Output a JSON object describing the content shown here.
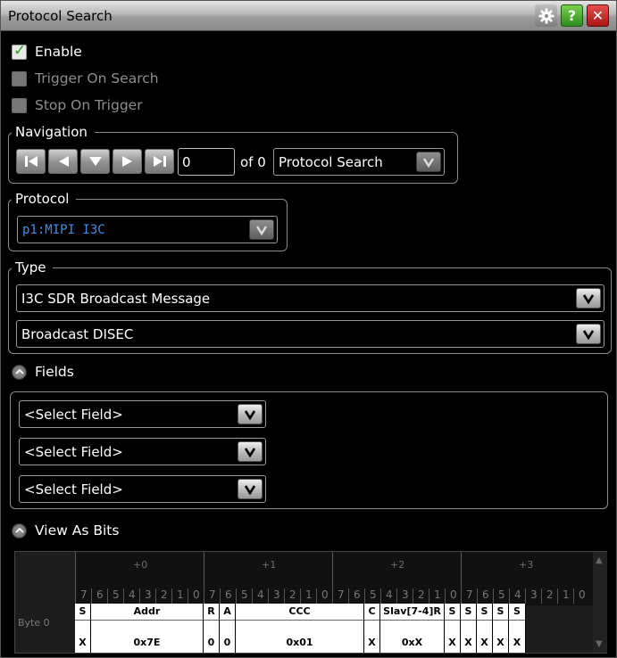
{
  "window": {
    "title": "Protocol Search"
  },
  "options": {
    "enable_label": "Enable",
    "trigger_on_search_label": "Trigger On Search",
    "stop_on_trigger_label": "Stop On Trigger"
  },
  "navigation": {
    "title": "Navigation",
    "index_value": "0",
    "of_label": "of 0",
    "mode_value": "Protocol Search"
  },
  "protocol": {
    "title": "Protocol",
    "value": "p1:MIPI I3C"
  },
  "type": {
    "title": "Type",
    "primary_value": "I3C SDR Broadcast Message",
    "secondary_value": "Broadcast DISEC"
  },
  "fields": {
    "title": "Fields",
    "selectors": [
      "<Select Field>",
      "<Select Field>",
      "<Select Field>"
    ]
  },
  "view_as_bits": {
    "title": "View As Bits",
    "byte_label": "Byte 0",
    "group_labels": [
      "+0",
      "+1",
      "+2",
      "+3"
    ],
    "bit_numbers": [
      "7",
      "6",
      "5",
      "4",
      "3",
      "2",
      "1",
      "0",
      "7",
      "6",
      "5",
      "4",
      "3",
      "2",
      "1",
      "0",
      "7",
      "6",
      "5",
      "4",
      "3",
      "2",
      "1",
      "0",
      "7",
      "6",
      "5",
      "4",
      "3",
      "2",
      "1",
      "0"
    ],
    "fields": [
      {
        "name": "S",
        "value": "X"
      },
      {
        "name": "Addr",
        "value": "0x7E"
      },
      {
        "name": "R",
        "value": "0"
      },
      {
        "name": "A",
        "value": "0"
      },
      {
        "name": "CCC",
        "value": "0x01"
      },
      {
        "name": "C",
        "value": "X"
      },
      {
        "name": "Slav[7-4]R",
        "value": "0xX"
      },
      {
        "name": "S",
        "value": "X"
      },
      {
        "name": "S",
        "value": "X"
      },
      {
        "name": "S",
        "value": "X"
      },
      {
        "name": "S",
        "value": "X"
      },
      {
        "name": "S",
        "value": "X"
      }
    ]
  },
  "colors": {
    "protocol_text": "#3f8ee8",
    "accent_green": "#2aa21a",
    "close_red": "#c22020"
  },
  "icons": {
    "settings": "gear-icon",
    "help": "question-icon",
    "close": "close-icon",
    "nav": [
      "first-icon",
      "previous-icon",
      "down-icon",
      "next-icon",
      "last-icon"
    ]
  }
}
